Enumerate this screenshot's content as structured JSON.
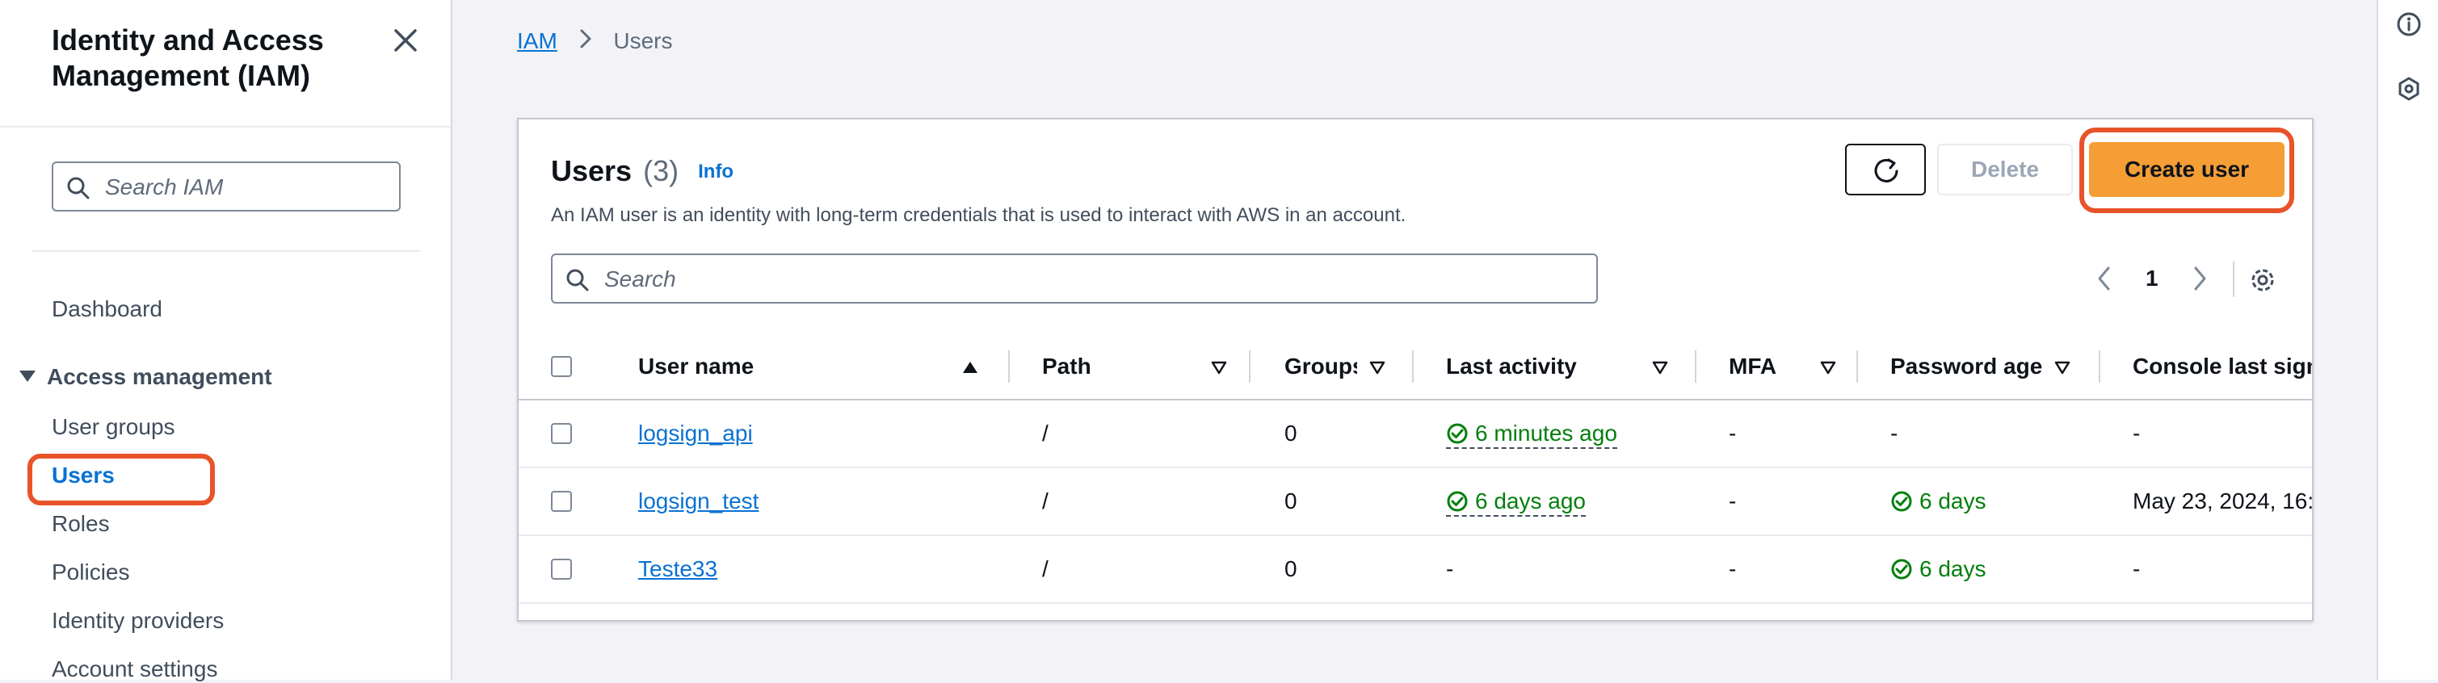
{
  "sidebar": {
    "title": "Identity and Access Management (IAM)",
    "search_placeholder": "Search IAM",
    "dashboard": "Dashboard",
    "section_title": "Access management",
    "items": [
      "User groups",
      "Users",
      "Roles",
      "Policies",
      "Identity providers",
      "Account settings"
    ],
    "active_item": "Users"
  },
  "breadcrumb": {
    "root": "IAM",
    "current": "Users"
  },
  "panel": {
    "title": "Users",
    "count": "(3)",
    "info_label": "Info",
    "description": "An IAM user is an identity with long-term credentials that is used to interact with AWS in an account.",
    "delete_label": "Delete",
    "create_label": "Create user",
    "search_placeholder": "Search",
    "page_number": "1"
  },
  "table": {
    "columns": [
      "User name",
      "Path",
      "Groups",
      "Last activity",
      "MFA",
      "Password age",
      "Console last sign-in"
    ],
    "rows": [
      {
        "user_name": "logsign_api",
        "path": "/",
        "groups": "0",
        "last_activity": "6 minutes ago",
        "mfa": "-",
        "password_age": "-",
        "console_last_signin": "-"
      },
      {
        "user_name": "logsign_test",
        "path": "/",
        "groups": "0",
        "last_activity": "6 days ago",
        "mfa": "-",
        "password_age": "6 days",
        "console_last_signin": "May 23, 2024, 16:"
      },
      {
        "user_name": "Teste33",
        "path": "/",
        "groups": "0",
        "last_activity": "-",
        "mfa": "-",
        "password_age": "6 days",
        "console_last_signin": "-"
      }
    ]
  },
  "colors": {
    "accent": "#0972d3",
    "primary_button": "#f59e35",
    "highlight": "#e8532a",
    "success": "#037f0c"
  }
}
